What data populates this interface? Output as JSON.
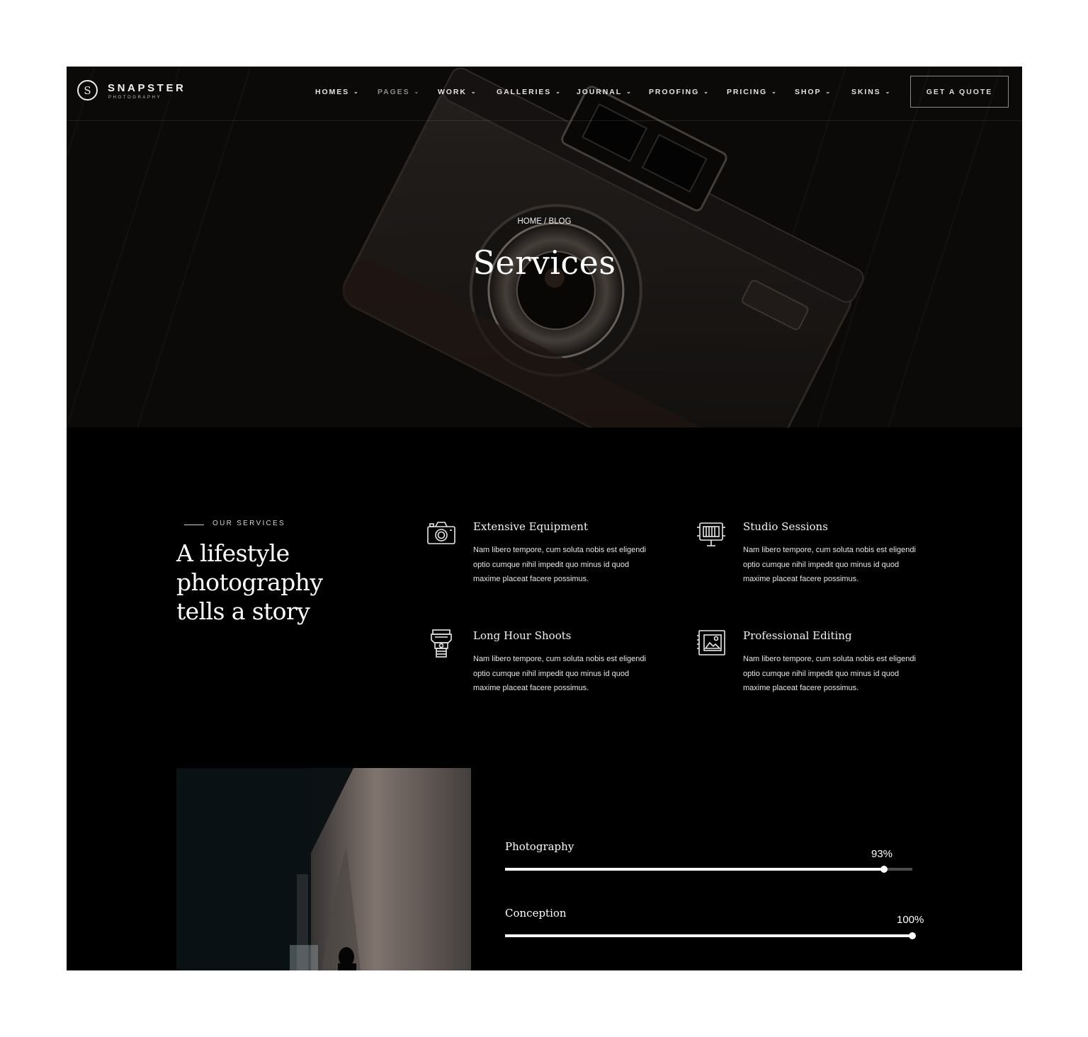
{
  "brand": {
    "name": "SNAPSTER",
    "tagline": "PHOTOGRAPHY",
    "logo_letter": "S"
  },
  "nav": {
    "items": [
      {
        "label": "HOMES",
        "dim": false
      },
      {
        "label": "PAGES",
        "dim": true
      },
      {
        "label": "WORK",
        "dim": false
      },
      {
        "label": "GALLERIES",
        "dim": false
      },
      {
        "label": "JOURNAL",
        "dim": false
      },
      {
        "label": "PROOFING",
        "dim": false
      },
      {
        "label": "PRICING",
        "dim": false
      },
      {
        "label": "SHOP",
        "dim": false
      },
      {
        "label": "SKINS",
        "dim": false
      }
    ],
    "cta": "GET A QUOTE"
  },
  "hero": {
    "breadcrumb": "HOME / BLOG",
    "title": "Services"
  },
  "intro": {
    "eyebrow": "OUR SERVICES",
    "heading": "A lifestyle photography tells a story"
  },
  "services": [
    {
      "icon": "camera-icon",
      "title": "Extensive Equipment",
      "text": "Nam libero tempore, cum soluta nobis est eligendi optio cumque nihil impedit quo minus id quod maxime placeat facere possimus."
    },
    {
      "icon": "studio-light-icon",
      "title": "Studio Sessions",
      "text": "Nam libero tempore, cum soluta nobis est eligendi optio cumque nihil impedit quo minus id quod maxime placeat facere possimus."
    },
    {
      "icon": "camera-lens-icon",
      "title": "Long Hour Shoots",
      "text": "Nam libero tempore, cum soluta nobis est eligendi optio cumque nihil impedit quo minus id quod maxime placeat facere possimus."
    },
    {
      "icon": "photo-editing-icon",
      "title": "Professional Editing",
      "text": "Nam libero tempore, cum soluta nobis est eligendi optio cumque nihil impedit quo minus id quod maxime placeat facere possimus."
    }
  ],
  "skills": [
    {
      "label": "Photography",
      "value_text": "93%",
      "value": 0.93
    },
    {
      "label": "Conception",
      "value_text": "100%",
      "value": 1.0
    }
  ],
  "colors": {
    "background": "#000000",
    "text": "#ffffff",
    "track": "#4b4b4b"
  }
}
